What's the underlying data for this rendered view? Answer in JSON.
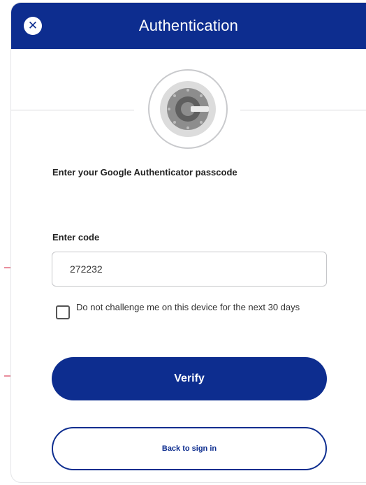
{
  "header": {
    "title": "Authentication",
    "close_icon": "close-icon",
    "close_glyph": "✕",
    "background_color": "#0d2d8f"
  },
  "logo": {
    "icon": "google-authenticator-icon"
  },
  "form": {
    "instruction": "Enter your Google Authenticator passcode",
    "code_label": "Enter code",
    "code_value": "272232",
    "remember_label": "Do not challenge me on this device for the next 30 days",
    "remember_checked": false
  },
  "actions": {
    "verify_label": "Verify",
    "back_label": "Back to sign in",
    "primary_color": "#0d2d8f"
  },
  "annotations": {
    "arrow_color": "#e2687d",
    "arrow_icon": "arrow-right-icon"
  }
}
